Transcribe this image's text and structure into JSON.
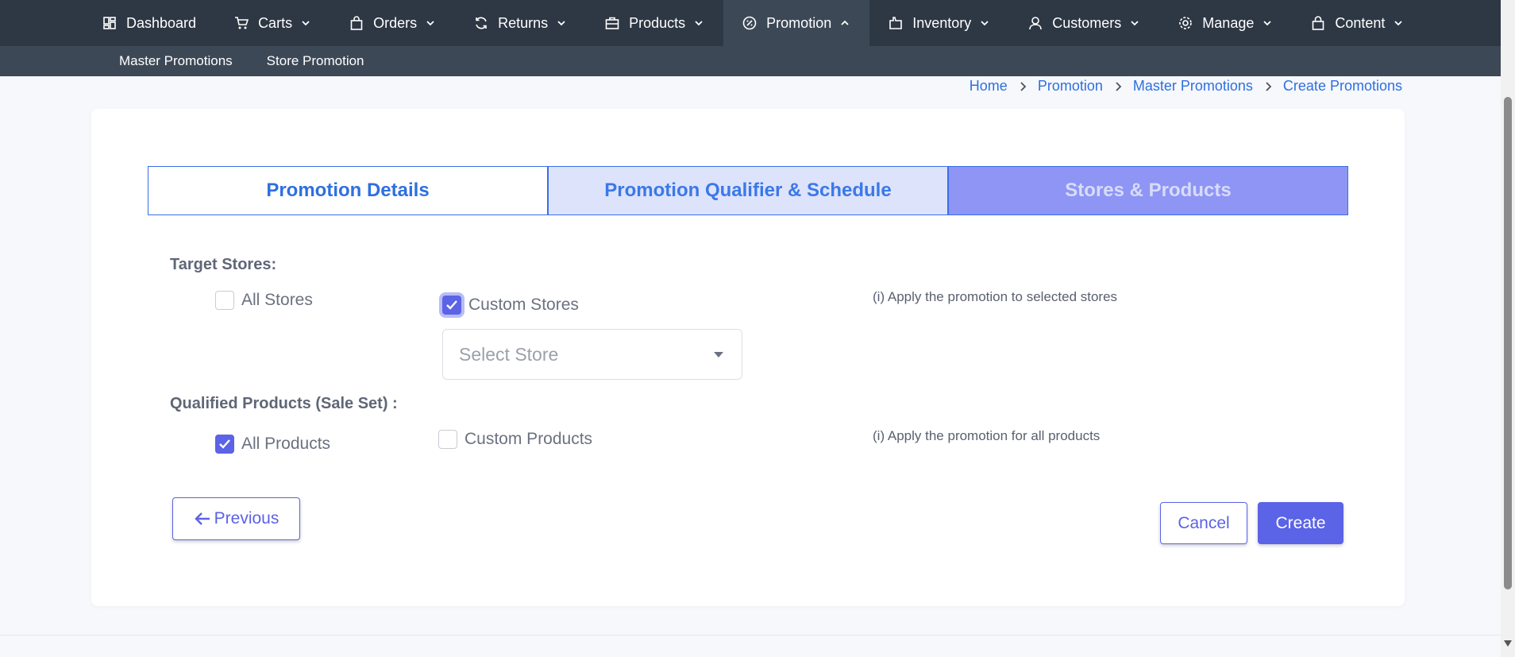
{
  "nav": {
    "items": [
      {
        "label": "Dashboard",
        "icon": "dashboard-icon",
        "has_chevron": false
      },
      {
        "label": "Carts",
        "icon": "cart-icon",
        "has_chevron": true
      },
      {
        "label": "Orders",
        "icon": "bag-icon",
        "has_chevron": true
      },
      {
        "label": "Returns",
        "icon": "refresh-icon",
        "has_chevron": true
      },
      {
        "label": "Products",
        "icon": "briefcase-icon",
        "has_chevron": true
      },
      {
        "label": "Promotion",
        "icon": "badge-percent-icon",
        "has_chevron": true,
        "active": true
      },
      {
        "label": "Inventory",
        "icon": "box-icon",
        "has_chevron": true
      },
      {
        "label": "Customers",
        "icon": "user-icon",
        "has_chevron": true
      },
      {
        "label": "Manage",
        "icon": "gear-icon",
        "has_chevron": true
      },
      {
        "label": "Content",
        "icon": "lock-bag-icon",
        "has_chevron": true
      }
    ],
    "subitems": [
      "Master Promotions",
      "Store Promotion"
    ]
  },
  "breadcrumb": [
    "Home",
    "Promotion",
    "Master Promotions",
    "Create Promotions"
  ],
  "tabs": [
    "Promotion Details",
    "Promotion Qualifier & Schedule",
    "Stores & Products"
  ],
  "target_stores": {
    "label": "Target Stores:",
    "all_stores": {
      "label": "All Stores",
      "checked": false
    },
    "custom_stores": {
      "label": "Custom Stores",
      "checked": true
    },
    "hint": "(i) Apply the promotion to selected stores",
    "select_placeholder": "Select Store"
  },
  "qualified_products": {
    "label": "Qualified Products (Sale Set) :",
    "all_products": {
      "label": "All Products",
      "checked": true
    },
    "custom_products": {
      "label": "Custom Products",
      "checked": false
    },
    "hint": "(i) Apply the promotion for all products"
  },
  "buttons": {
    "previous": "Previous",
    "cancel": "Cancel",
    "create": "Create"
  },
  "colors": {
    "nav_bg": "#2e3744",
    "subnav_bg": "#3d4857",
    "accent": "#5b63e6",
    "link": "#2f6fe0"
  }
}
